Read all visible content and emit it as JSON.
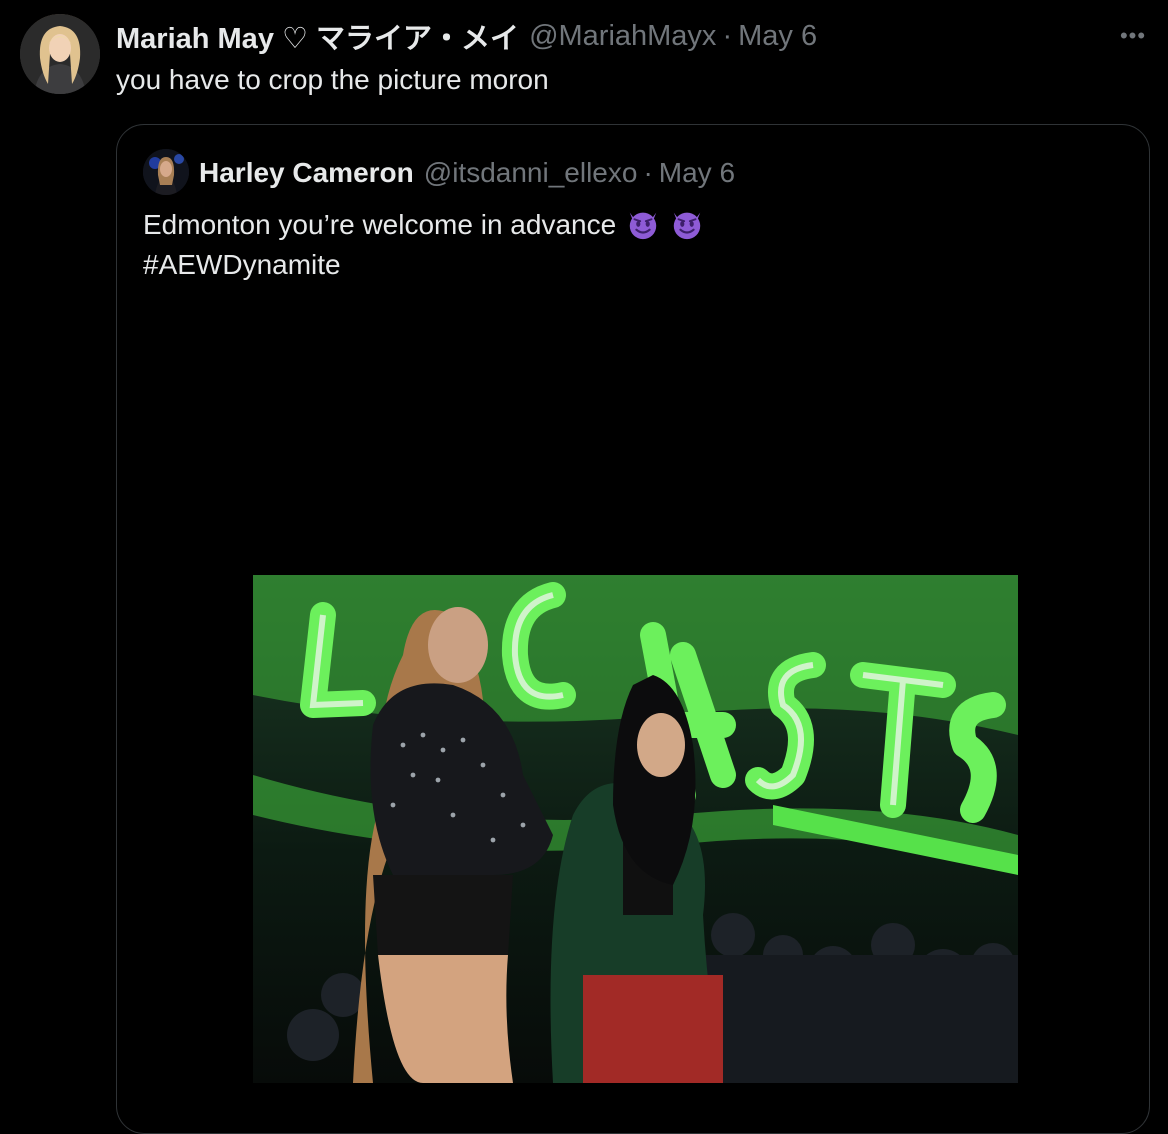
{
  "tweet": {
    "display_name": "Mariah May ♡ マライア・メイ",
    "handle": "@MariahMayx",
    "separator": "·",
    "date": "May 6",
    "text": "you have to crop the picture moron",
    "more_label": "•••",
    "avatar_icon": "profile-avatar"
  },
  "quoted_tweet": {
    "display_name": "Harley Cameron",
    "handle": "@itsdanni_ellexo",
    "separator": "·",
    "date": "May 6",
    "text_line_1": "Edmonton you’re welcome in advance",
    "text_line_2": "#AEWDynamite",
    "emoji_icon": "smiling-imp-emoji",
    "avatar_icon": "profile-avatar",
    "media_icon": "photo-media",
    "media_lettering": "OUTCASTS"
  },
  "colors": {
    "background": "#000000",
    "primary_text": "#e7e9ea",
    "secondary_text": "#71767b",
    "border": "#2f3336",
    "emoji_purple": "#8e5bd6",
    "media_green": "#5de34f"
  }
}
